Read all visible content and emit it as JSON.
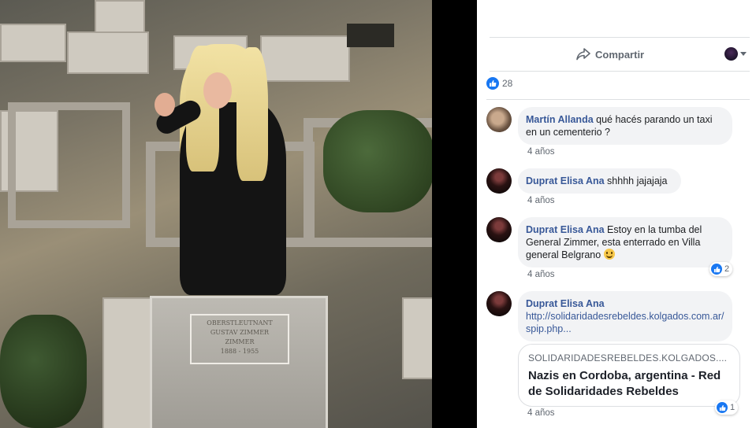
{
  "photo": {
    "plaque_lines": [
      "OBERSTLEUTNANT",
      "GUSTAV ZIMMER",
      "ZIMMER",
      "1888 - 1955"
    ]
  },
  "actions": {
    "share_label": "Compartir"
  },
  "likes": {
    "count": "28"
  },
  "comments": [
    {
      "author": "Martín Allanda",
      "text": "qué hacés parando un taxi en un cementerio ?",
      "time": "4 años"
    },
    {
      "author": "Duprat Elisa Ana",
      "text": "shhhh jajajaja",
      "time": "4 años"
    },
    {
      "author": "Duprat Elisa Ana",
      "text": "Estoy en la tumba del General Zimmer, esta enterrado en Villa general Belgrano",
      "time": "4 años",
      "reactions": "2"
    },
    {
      "author": "Duprat Elisa Ana",
      "link": "http://solidaridadesrebeldes.kolgados.com.ar/spip.php...",
      "preview": {
        "domain": "SOLIDARIDADESREBELDES.KOLGADOS....",
        "title": "Nazis en Cordoba, argentina - Red de Solidaridades Rebeldes"
      },
      "time": "4 años",
      "reactions": "1"
    }
  ],
  "colors": {
    "link": "#385898",
    "like": "#1877f2",
    "bubble": "#f2f3f5",
    "meta": "#606770"
  },
  "icons": [
    "share-icon",
    "like-icon",
    "chevron-down-icon",
    "smiley-icon"
  ]
}
